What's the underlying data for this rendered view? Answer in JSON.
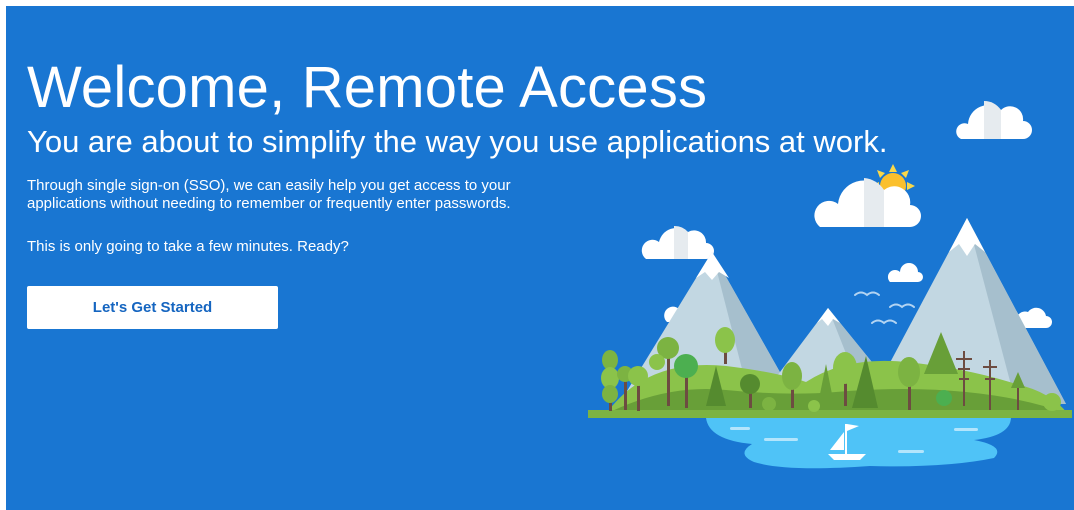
{
  "welcome": {
    "title": "Welcome, Remote Access",
    "subtitle": "You are about to simplify the way you use applications at work.",
    "intro": "Through single sign-on (SSO), we can easily help you get access to your applications without needing to remember or frequently enter passwords.",
    "ready": "This is only going to take a few minutes. Ready?",
    "start_label": "Let's Get Started"
  },
  "colors": {
    "background": "#1976d2",
    "button_text": "#1565c0"
  }
}
